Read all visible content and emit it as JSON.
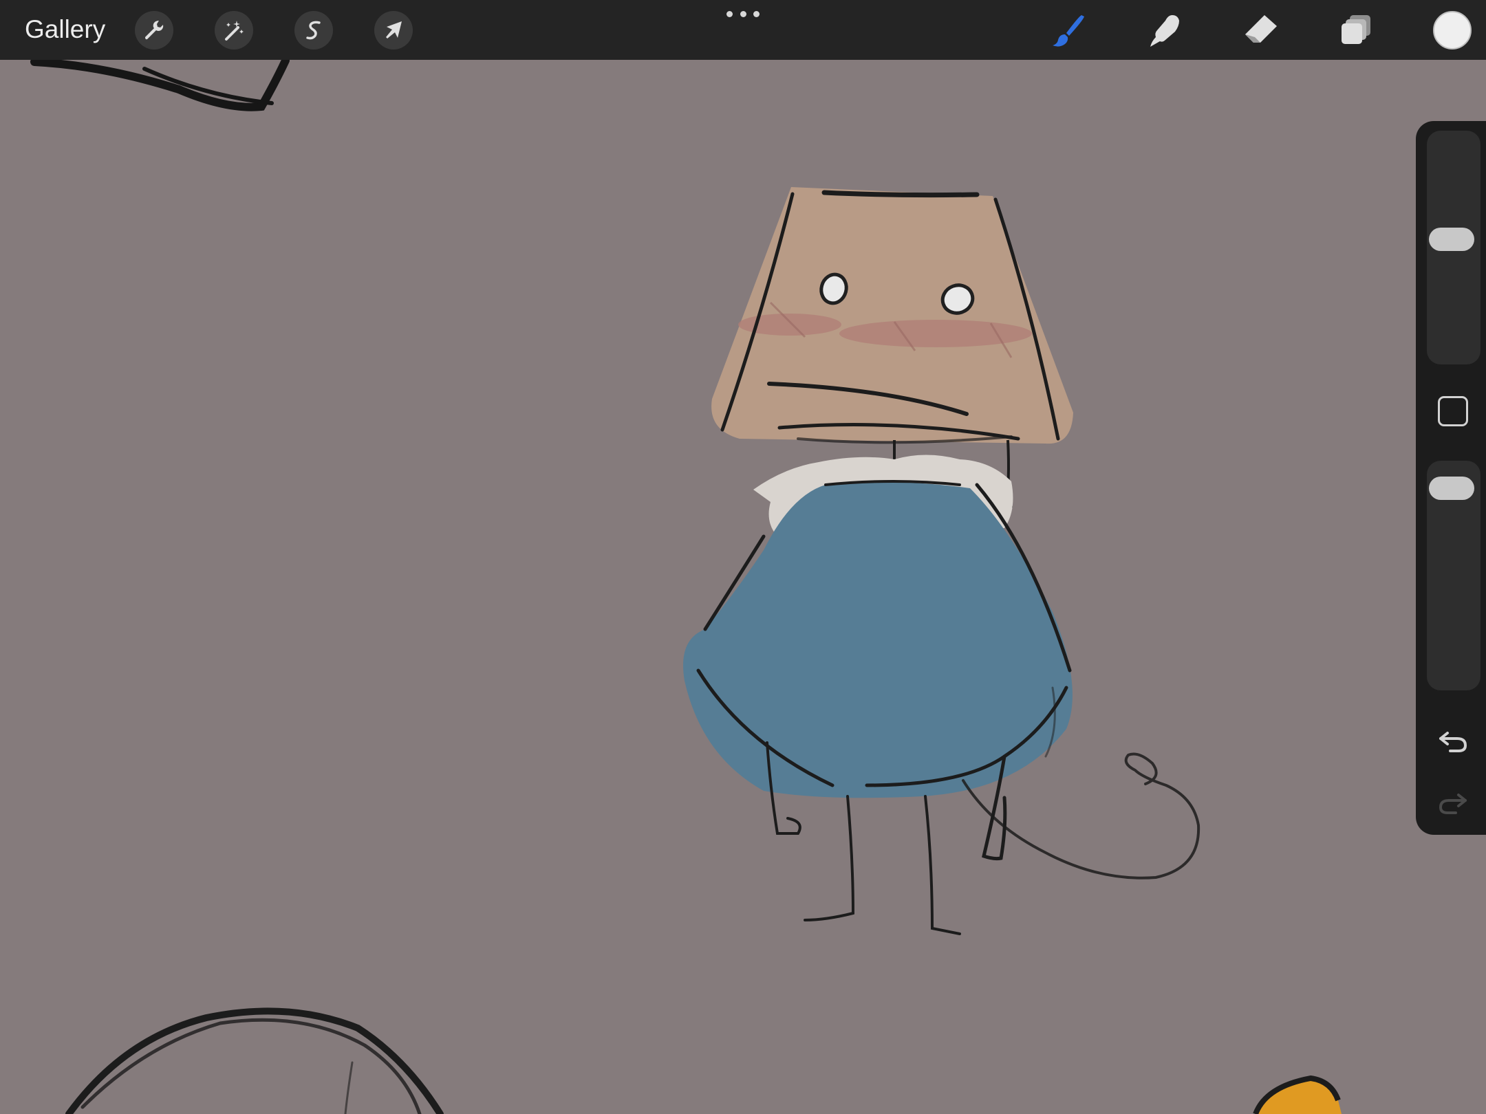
{
  "topbar": {
    "gallery_label": "Gallery",
    "left_tools": [
      {
        "name": "actions",
        "icon": "wrench-icon"
      },
      {
        "name": "adjustments",
        "icon": "magic-wand-icon"
      },
      {
        "name": "selection",
        "icon": "selection-s-icon"
      },
      {
        "name": "transform",
        "icon": "arrow-cursor-icon"
      }
    ],
    "center": {
      "icon": "more-dots-icon"
    },
    "right_tools": [
      {
        "name": "brush",
        "icon": "brush-icon",
        "active": true
      },
      {
        "name": "smudge",
        "icon": "smudge-finger-icon",
        "active": false
      },
      {
        "name": "eraser",
        "icon": "eraser-icon",
        "active": false
      },
      {
        "name": "layers",
        "icon": "layers-icon",
        "active": false
      }
    ],
    "current_color": "#efefef",
    "active_tool_color": "#2f6fe0",
    "icon_color": "#e0e0e0"
  },
  "sidebar": {
    "brush_size_level": 0.46,
    "opacity_level": 0.06,
    "modify_button": {
      "icon": "square-icon"
    },
    "undo": {
      "icon": "undo-icon",
      "enabled": true
    },
    "redo": {
      "icon": "redo-icon",
      "enabled": false
    }
  },
  "canvas": {
    "background_color": "#857b7c",
    "shade_color": "#b89b86",
    "coat_color": "#567d95",
    "collar_color": "#d9d4cf",
    "blush_color": "#b07d75",
    "line_color": "#1c1c1c"
  }
}
